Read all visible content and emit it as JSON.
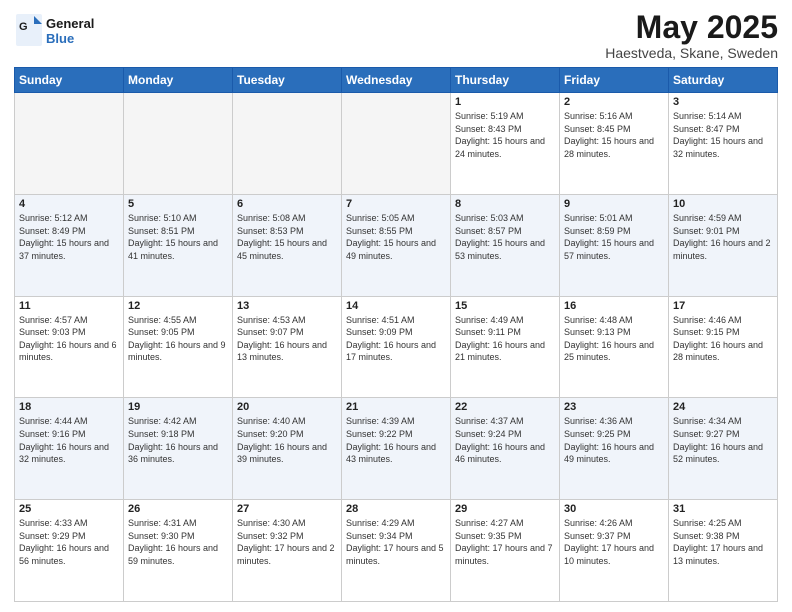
{
  "logo": {
    "line1": "General",
    "line2": "Blue"
  },
  "title": "May 2025",
  "subtitle": "Haestveda, Skane, Sweden",
  "weekdays": [
    "Sunday",
    "Monday",
    "Tuesday",
    "Wednesday",
    "Thursday",
    "Friday",
    "Saturday"
  ],
  "weeks": [
    [
      {
        "day": "",
        "empty": true
      },
      {
        "day": "",
        "empty": true
      },
      {
        "day": "",
        "empty": true
      },
      {
        "day": "",
        "empty": true
      },
      {
        "day": "1",
        "sunrise": "5:19 AM",
        "sunset": "8:43 PM",
        "daylight": "15 hours and 24 minutes."
      },
      {
        "day": "2",
        "sunrise": "5:16 AM",
        "sunset": "8:45 PM",
        "daylight": "15 hours and 28 minutes."
      },
      {
        "day": "3",
        "sunrise": "5:14 AM",
        "sunset": "8:47 PM",
        "daylight": "15 hours and 32 minutes."
      }
    ],
    [
      {
        "day": "4",
        "sunrise": "5:12 AM",
        "sunset": "8:49 PM",
        "daylight": "15 hours and 37 minutes."
      },
      {
        "day": "5",
        "sunrise": "5:10 AM",
        "sunset": "8:51 PM",
        "daylight": "15 hours and 41 minutes."
      },
      {
        "day": "6",
        "sunrise": "5:08 AM",
        "sunset": "8:53 PM",
        "daylight": "15 hours and 45 minutes."
      },
      {
        "day": "7",
        "sunrise": "5:05 AM",
        "sunset": "8:55 PM",
        "daylight": "15 hours and 49 minutes."
      },
      {
        "day": "8",
        "sunrise": "5:03 AM",
        "sunset": "8:57 PM",
        "daylight": "15 hours and 53 minutes."
      },
      {
        "day": "9",
        "sunrise": "5:01 AM",
        "sunset": "8:59 PM",
        "daylight": "15 hours and 57 minutes."
      },
      {
        "day": "10",
        "sunrise": "4:59 AM",
        "sunset": "9:01 PM",
        "daylight": "16 hours and 2 minutes."
      }
    ],
    [
      {
        "day": "11",
        "sunrise": "4:57 AM",
        "sunset": "9:03 PM",
        "daylight": "16 hours and 6 minutes."
      },
      {
        "day": "12",
        "sunrise": "4:55 AM",
        "sunset": "9:05 PM",
        "daylight": "16 hours and 9 minutes."
      },
      {
        "day": "13",
        "sunrise": "4:53 AM",
        "sunset": "9:07 PM",
        "daylight": "16 hours and 13 minutes."
      },
      {
        "day": "14",
        "sunrise": "4:51 AM",
        "sunset": "9:09 PM",
        "daylight": "16 hours and 17 minutes."
      },
      {
        "day": "15",
        "sunrise": "4:49 AM",
        "sunset": "9:11 PM",
        "daylight": "16 hours and 21 minutes."
      },
      {
        "day": "16",
        "sunrise": "4:48 AM",
        "sunset": "9:13 PM",
        "daylight": "16 hours and 25 minutes."
      },
      {
        "day": "17",
        "sunrise": "4:46 AM",
        "sunset": "9:15 PM",
        "daylight": "16 hours and 28 minutes."
      }
    ],
    [
      {
        "day": "18",
        "sunrise": "4:44 AM",
        "sunset": "9:16 PM",
        "daylight": "16 hours and 32 minutes."
      },
      {
        "day": "19",
        "sunrise": "4:42 AM",
        "sunset": "9:18 PM",
        "daylight": "16 hours and 36 minutes."
      },
      {
        "day": "20",
        "sunrise": "4:40 AM",
        "sunset": "9:20 PM",
        "daylight": "16 hours and 39 minutes."
      },
      {
        "day": "21",
        "sunrise": "4:39 AM",
        "sunset": "9:22 PM",
        "daylight": "16 hours and 43 minutes."
      },
      {
        "day": "22",
        "sunrise": "4:37 AM",
        "sunset": "9:24 PM",
        "daylight": "16 hours and 46 minutes."
      },
      {
        "day": "23",
        "sunrise": "4:36 AM",
        "sunset": "9:25 PM",
        "daylight": "16 hours and 49 minutes."
      },
      {
        "day": "24",
        "sunrise": "4:34 AM",
        "sunset": "9:27 PM",
        "daylight": "16 hours and 52 minutes."
      }
    ],
    [
      {
        "day": "25",
        "sunrise": "4:33 AM",
        "sunset": "9:29 PM",
        "daylight": "16 hours and 56 minutes."
      },
      {
        "day": "26",
        "sunrise": "4:31 AM",
        "sunset": "9:30 PM",
        "daylight": "16 hours and 59 minutes."
      },
      {
        "day": "27",
        "sunrise": "4:30 AM",
        "sunset": "9:32 PM",
        "daylight": "17 hours and 2 minutes."
      },
      {
        "day": "28",
        "sunrise": "4:29 AM",
        "sunset": "9:34 PM",
        "daylight": "17 hours and 5 minutes."
      },
      {
        "day": "29",
        "sunrise": "4:27 AM",
        "sunset": "9:35 PM",
        "daylight": "17 hours and 7 minutes."
      },
      {
        "day": "30",
        "sunrise": "4:26 AM",
        "sunset": "9:37 PM",
        "daylight": "17 hours and 10 minutes."
      },
      {
        "day": "31",
        "sunrise": "4:25 AM",
        "sunset": "9:38 PM",
        "daylight": "17 hours and 13 minutes."
      }
    ]
  ]
}
